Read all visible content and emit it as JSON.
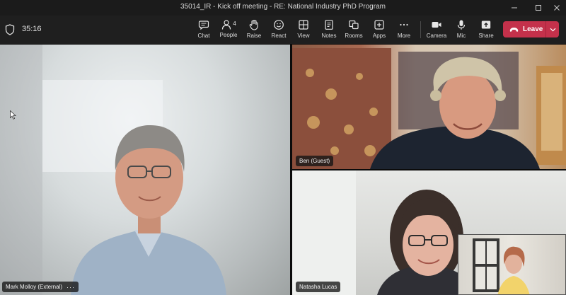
{
  "window": {
    "title": "35014_IR - Kick off meeting - RE: National Industry PhD Program"
  },
  "toolbar": {
    "timer": "35:16",
    "buttons": [
      {
        "key": "chat",
        "label": "Chat",
        "icon": "chat-icon"
      },
      {
        "key": "people",
        "label": "People",
        "icon": "people-icon",
        "badge": "4"
      },
      {
        "key": "raise",
        "label": "Raise",
        "icon": "hand-icon"
      },
      {
        "key": "react",
        "label": "React",
        "icon": "smile-icon"
      },
      {
        "key": "view",
        "label": "View",
        "icon": "grid-icon"
      },
      {
        "key": "notes",
        "label": "Notes",
        "icon": "notes-icon"
      },
      {
        "key": "rooms",
        "label": "Rooms",
        "icon": "rooms-icon"
      },
      {
        "key": "apps",
        "label": "Apps",
        "icon": "apps-icon"
      },
      {
        "key": "more",
        "label": "More",
        "icon": "more-icon"
      },
      {
        "key": "camera",
        "label": "Camera",
        "icon": "camera-icon"
      },
      {
        "key": "mic",
        "label": "Mic",
        "icon": "mic-icon"
      },
      {
        "key": "share",
        "label": "Share",
        "icon": "share-icon"
      }
    ],
    "leave_label": "Leave"
  },
  "participants": {
    "main": {
      "name": "Mark Molloy (External)",
      "more": "···"
    },
    "ben": {
      "name": "Ben (Guest)"
    },
    "natasha": {
      "name": "Natasha Lucas"
    }
  },
  "colors": {
    "leave": "#c4314b",
    "toolbar": "#1f1f1f",
    "titlebar": "#1b1b1b"
  }
}
